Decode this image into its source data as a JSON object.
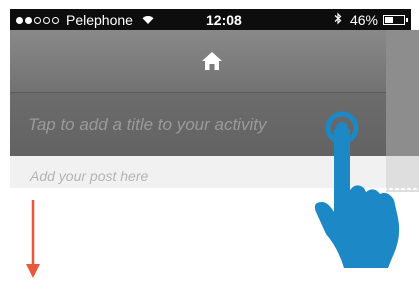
{
  "status_bar": {
    "signal_full": 2,
    "signal_total": 5,
    "carrier": "Pelephone",
    "time": "12:08",
    "battery": "46%",
    "battery_level": 0.46,
    "icons": [
      "signal-dots-icon",
      "wifi-icon",
      "bluetooth-icon",
      "battery-icon"
    ]
  },
  "header": {
    "icon": "home-icon"
  },
  "activity": {
    "title_placeholder": "Tap to add a title to your activity",
    "post_placeholder": "Add your post here"
  },
  "overlay": {
    "gesture": "tap-hand-icon",
    "arrow": "down-arrow-icon",
    "accent_color": "#1c88c6",
    "arrow_color": "#e8583a"
  }
}
